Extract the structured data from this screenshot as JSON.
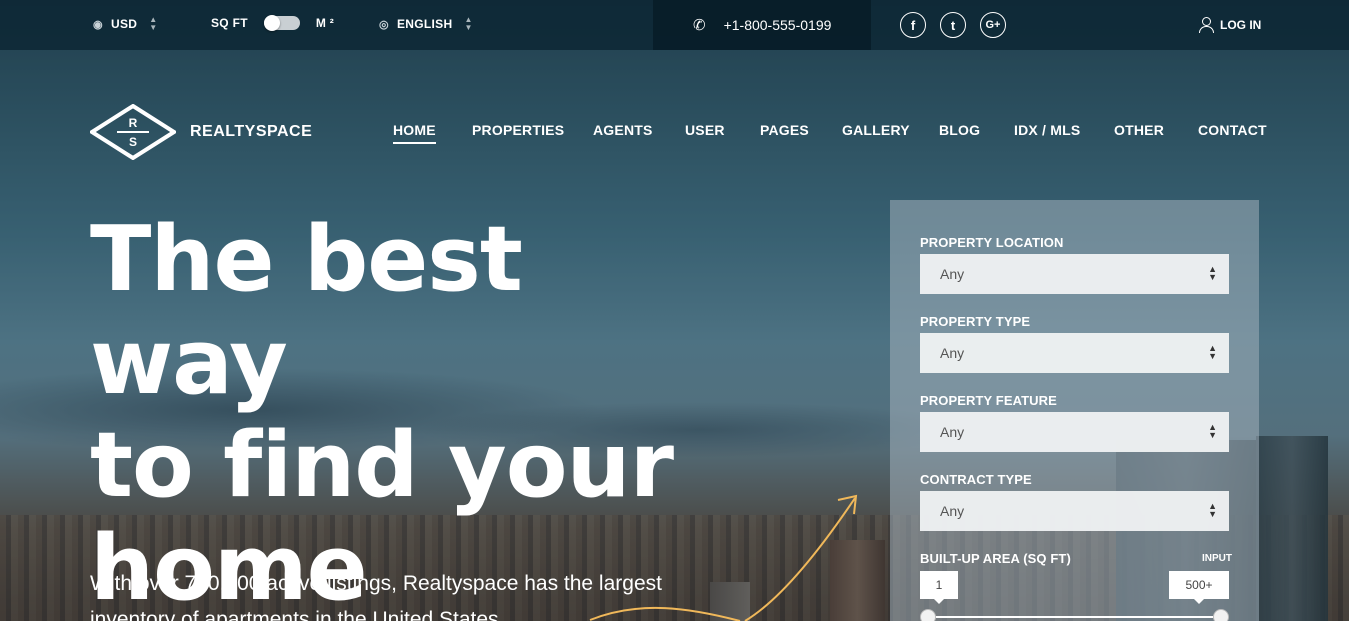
{
  "topbar": {
    "currency": "USD",
    "unit_left": "SQ FT",
    "unit_right": "M ²",
    "language": "ENGLISH",
    "phone": "+1-800-555-0199",
    "social": [
      "f",
      "t",
      "G+"
    ],
    "login": "LOG IN"
  },
  "header": {
    "logo_top_letter": "R",
    "logo_bottom_letter": "S",
    "brand": "REALTYSPACE",
    "nav": [
      "HOME",
      "PROPERTIES",
      "AGENTS",
      "USER",
      "PAGES",
      "GALLERY",
      "BLOG",
      "IDX / MLS",
      "OTHER",
      "CONTACT"
    ],
    "active_nav": "HOME"
  },
  "hero": {
    "headline_line1": "The best way",
    "headline_line2": "to find your",
    "headline_line3": "home",
    "subheading": "With over 700,000 active listings, Realtyspace has the largest inventory of apartments in the United States."
  },
  "search": {
    "location_label": "PROPERTY LOCATION",
    "location_value": "Any",
    "type_label": "PROPERTY TYPE",
    "type_value": "Any",
    "feature_label": "PROPERTY FEATURE",
    "feature_value": "Any",
    "contract_label": "CONTRACT TYPE",
    "contract_value": "Any",
    "area_label": "BUILT-UP AREA (SQ FT)",
    "input_label": "INPUT",
    "area_min": "1",
    "area_max": "500+"
  },
  "colors": {
    "topbar_bg": "#0a2330",
    "panel_bg": "#a0afb9",
    "accent_arrow": "#f0b85a"
  }
}
